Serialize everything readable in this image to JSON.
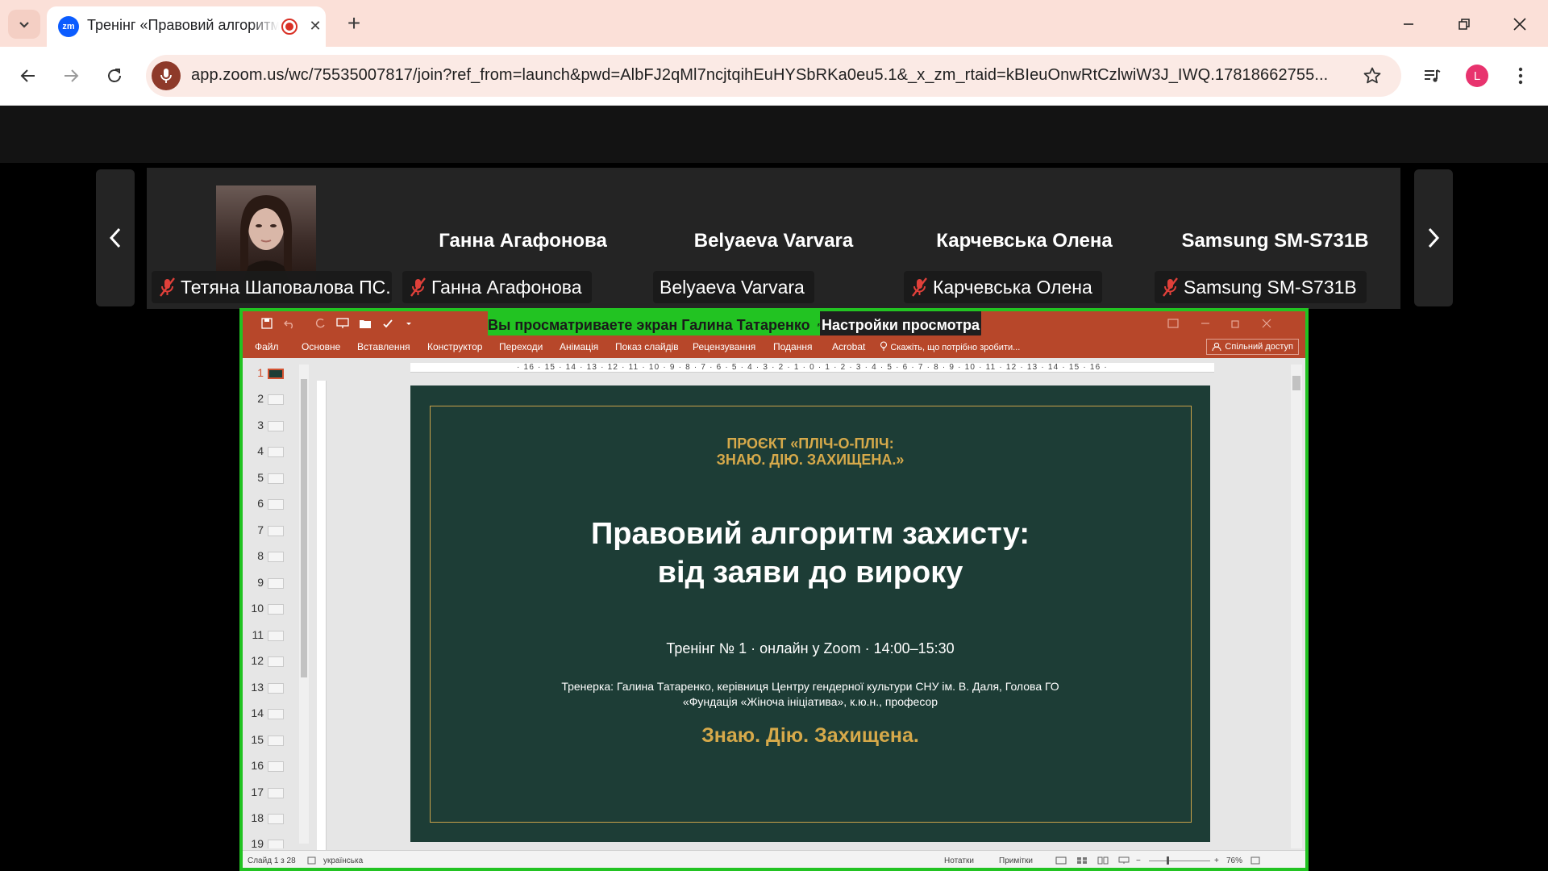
{
  "browser": {
    "tab_title": "Тренінг «Правовий алгоритм захисту»",
    "tab_favicon": "zm",
    "url": "app.zoom.us/wc/75535007817/join?ref_from=launch&pwd=AlbFJ2qMl7ncjtqihEuHYSbRKa0eu5.1&_x_zm_rtaid=kBIeuOnwRtCzlwiW3J_IWQ.17818662755...",
    "profile_initial": "L",
    "accent_color": "#fbe0d8",
    "profile_color": "#e8336e"
  },
  "participants": [
    {
      "name": "",
      "label": "Тетяна Шаповалова ПС...",
      "muted": true,
      "has_video": true
    },
    {
      "name": "Ганна Агафонова",
      "label": "Ганна Агафонова",
      "muted": true,
      "has_video": false
    },
    {
      "name": "Belyaeva Varvara",
      "label": "Belyaeva Varvara",
      "muted": false,
      "has_video": false
    },
    {
      "name": "Карчевська Олена",
      "label": "Карчевська Олена",
      "muted": true,
      "has_video": false
    },
    {
      "name": "Samsung SM-S731B",
      "label": "Samsung SM-S731B",
      "muted": true,
      "has_video": false
    }
  ],
  "share": {
    "banner_text": "Вы просматриваете экран  Галина Татаренко",
    "view_options": "Настройки просмотра",
    "frame_color": "#22c322"
  },
  "powerpoint": {
    "ribbon_tabs": [
      "Файл",
      "Основне",
      "Вставлення",
      "Конструктор",
      "Переходи",
      "Анімація",
      "Показ слайдів",
      "Рецензування",
      "Подання",
      "Acrobat"
    ],
    "tell_me": "Скажіть, що потрібно зробити...",
    "share_button": "Спільний доступ",
    "ruler": "· 16 · 15 · 14 · 13 · 12 · 11 · 10 · 9 · 8 · 7 · 6 · 5 · 4 · 3 · 2 · 1 · 0 · 1 · 2 · 3 · 4 · 5 · 6 · 7 · 8 · 9 · 10 · 11 · 12 · 13 · 14 · 15 · 16 ·",
    "slide_numbers": [
      "1",
      "2",
      "3",
      "4",
      "5",
      "6",
      "7",
      "8",
      "9",
      "10",
      "11",
      "12",
      "13",
      "14",
      "15",
      "16",
      "17",
      "18",
      "19"
    ],
    "status": {
      "slide_counter": "Слайд 1 з 28",
      "language": "українська",
      "notes": "Нотатки",
      "comments": "Примітки",
      "zoom": "76%"
    },
    "slide_bg": "#1d3d36",
    "slide_accent": "#d6a94a"
  },
  "slide": {
    "project_line1": "ПРОЄКТ «ПЛІЧ-О-ПЛІЧ:",
    "project_line2": "ЗНАЮ. ДІЮ. ЗАХИЩЕНА.»",
    "title_line1": "Правовий алгоритм захисту:",
    "title_line2": "від заяви до вироку",
    "subtitle": "Тренінг № 1 · онлайн у Zoom · 14:00–15:30",
    "trainer_line1": "Тренерка: Галина Татаренко, керівниця Центру гендерної культури СНУ ім. В. Даля, Голова ГО",
    "trainer_line2": "«Фундація «Жіноча ініціатива», к.ю.н., професор",
    "motto": "Знаю. Дію. Захищена."
  }
}
